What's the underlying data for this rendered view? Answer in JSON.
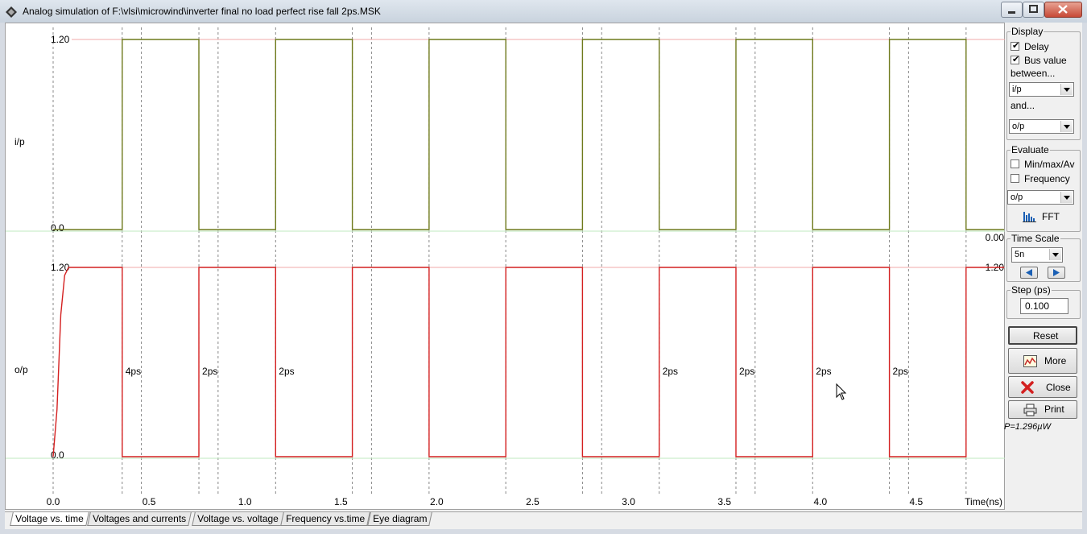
{
  "window": {
    "title": "Analog simulation of F:\\vlsi\\microwind\\inverter final no load perfect rise fall 2ps.MSK",
    "min_icon": "minimize-icon",
    "max_icon": "maximize-icon",
    "close_icon": "close-icon"
  },
  "chart_data": [
    {
      "type": "line",
      "title": "",
      "xlabel": "Time(ns)",
      "ylabel": "i/p",
      "xlim": [
        0.0,
        5.0
      ],
      "ylim": [
        0.0,
        1.2
      ],
      "x_ticks": [
        "0.0",
        "0.5",
        "1.0",
        "1.5",
        "2.0",
        "2.5",
        "3.0",
        "3.5",
        "4.0",
        "4.5"
      ],
      "y_ticks": [
        "1.20",
        "0.0"
      ],
      "right_value": "0.00",
      "series": [
        {
          "name": "i/p",
          "color": "#6f7a1c",
          "points": [
            [
              0.0,
              0.0
            ],
            [
              0.36,
              0.0
            ],
            [
              0.36,
              1.2
            ],
            [
              0.76,
              1.2
            ],
            [
              0.76,
              0.0
            ],
            [
              1.16,
              0.0
            ],
            [
              1.16,
              1.2
            ],
            [
              1.56,
              1.2
            ],
            [
              1.56,
              0.0
            ],
            [
              1.96,
              0.0
            ],
            [
              1.96,
              1.2
            ],
            [
              2.36,
              1.2
            ],
            [
              2.36,
              0.0
            ],
            [
              2.76,
              0.0
            ],
            [
              2.76,
              1.2
            ],
            [
              3.16,
              1.2
            ],
            [
              3.16,
              0.0
            ],
            [
              3.56,
              0.0
            ],
            [
              3.56,
              1.2
            ],
            [
              3.96,
              1.2
            ],
            [
              3.96,
              0.0
            ],
            [
              4.36,
              0.0
            ],
            [
              4.36,
              1.2
            ],
            [
              4.76,
              1.2
            ],
            [
              4.76,
              0.0
            ],
            [
              5.0,
              0.0
            ]
          ]
        }
      ]
    },
    {
      "type": "line",
      "title": "",
      "xlabel": "Time(ns)",
      "ylabel": "o/p",
      "xlim": [
        0.0,
        5.0
      ],
      "ylim": [
        0.0,
        1.2
      ],
      "y_ticks": [
        "1.20",
        "0.0"
      ],
      "right_value": "1.20",
      "series": [
        {
          "name": "o/p",
          "color": "#d42020",
          "points": [
            [
              0.0,
              0.0
            ],
            [
              0.02,
              0.3
            ],
            [
              0.04,
              0.9
            ],
            [
              0.06,
              1.15
            ],
            [
              0.08,
              1.2
            ],
            [
              0.36,
              1.2
            ],
            [
              0.36,
              0.0
            ],
            [
              0.76,
              0.0
            ],
            [
              0.76,
              1.2
            ],
            [
              1.16,
              1.2
            ],
            [
              1.16,
              0.0
            ],
            [
              1.56,
              0.0
            ],
            [
              1.56,
              1.2
            ],
            [
              1.96,
              1.2
            ],
            [
              1.96,
              0.0
            ],
            [
              2.36,
              0.0
            ],
            [
              2.36,
              1.2
            ],
            [
              2.76,
              1.2
            ],
            [
              2.76,
              0.0
            ],
            [
              3.16,
              0.0
            ],
            [
              3.16,
              1.2
            ],
            [
              3.56,
              1.2
            ],
            [
              3.56,
              0.0
            ],
            [
              3.96,
              0.0
            ],
            [
              3.96,
              1.2
            ],
            [
              4.36,
              1.2
            ],
            [
              4.36,
              0.0
            ],
            [
              4.76,
              0.0
            ],
            [
              4.76,
              1.2
            ],
            [
              5.0,
              1.2
            ]
          ]
        }
      ],
      "annotations": [
        {
          "x": 0.36,
          "text": "4ps"
        },
        {
          "x": 0.76,
          "text": "2ps"
        },
        {
          "x": 1.16,
          "text": "2ps"
        },
        {
          "x": 3.16,
          "text": "2ps"
        },
        {
          "x": 3.56,
          "text": "2ps"
        },
        {
          "x": 3.96,
          "text": "2ps"
        },
        {
          "x": 4.36,
          "text": "2ps"
        }
      ],
      "marker_lines_x": [
        0.0,
        0.36,
        0.46,
        0.76,
        0.86,
        1.16,
        1.56,
        1.66,
        1.96,
        2.36,
        2.76,
        2.86,
        3.16,
        3.56,
        3.66,
        3.96,
        4.36,
        4.46,
        4.76
      ]
    }
  ],
  "panel": {
    "display": {
      "label": "Display",
      "delay_label": "Delay",
      "delay_checked": true,
      "bus_label": "Bus value",
      "bus_checked": true,
      "between_label": "between...",
      "between_value": "i/p",
      "and_label": "and...",
      "and_value": "o/p"
    },
    "evaluate": {
      "label": "Evaluate",
      "minmax_label": "Min/max/Av",
      "minmax_checked": false,
      "freq_label": "Frequency",
      "freq_checked": false,
      "signal_value": "o/p",
      "fft_label": "FFT"
    },
    "timescale": {
      "label": "Time Scale",
      "value": "5n"
    },
    "step": {
      "label": "Step (ps)",
      "value": "0.100"
    },
    "buttons": {
      "reset": "Reset",
      "more": "More",
      "close": "Close",
      "print": "Print"
    },
    "power": "P=1.296µW"
  },
  "tabs": [
    {
      "label": "Voltage vs. time",
      "active": true
    },
    {
      "label": "Voltages and currents",
      "active": false
    },
    {
      "label": "Voltage vs. voltage",
      "active": false
    },
    {
      "label": "Frequency vs.time",
      "active": false
    },
    {
      "label": "Eye diagram",
      "active": false
    }
  ]
}
